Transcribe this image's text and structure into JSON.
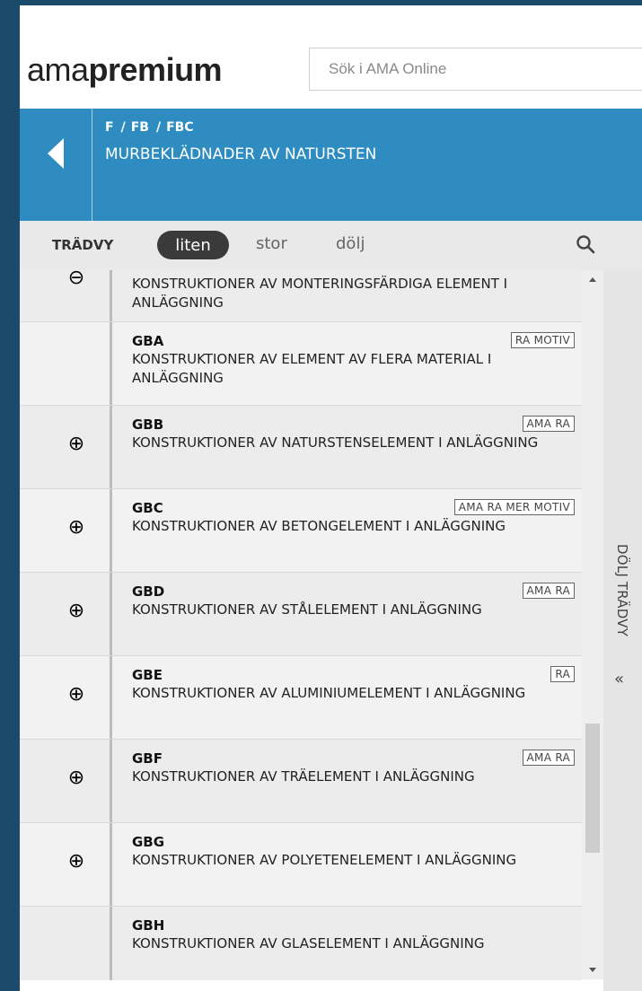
{
  "app": {
    "logo_part1": "ama",
    "logo_part2": "premium",
    "search_placeholder": "Sök i AMA Online"
  },
  "breadcrumb": {
    "items": [
      "F",
      "FB",
      "FBC"
    ],
    "separator": "/"
  },
  "section_title": "MURBEKLÄDNADER AV NATURSTEN",
  "treeview": {
    "label": "TRÄDVY",
    "options": [
      "liten",
      "stor",
      "dölj"
    ],
    "selected": "liten"
  },
  "hide_panel": {
    "label": "DÖLJ TRÄDVY",
    "icon": "double-chevron-left-icon"
  },
  "rows": [
    {
      "code": "",
      "desc": "KONSTRUKTIONER AV MONTERINGSFÄRDIGA ELEMENT I ANLÄGGNING",
      "badge": "",
      "toggle": "⊖"
    },
    {
      "code": "GBA",
      "desc": "KONSTRUKTIONER AV ELEMENT AV FLERA MATERIAL I ANLÄGGNING",
      "badge": "RA MOTIV",
      "toggle": ""
    },
    {
      "code": "GBB",
      "desc": "KONSTRUKTIONER AV NATURSTENSELEMENT I ANLÄGGNING",
      "badge": "AMA RA",
      "toggle": "⊕"
    },
    {
      "code": "GBC",
      "desc": "KONSTRUKTIONER AV BETONGELEMENT I ANLÄGGNING",
      "badge": "AMA RA MER MOTIV",
      "toggle": "⊕"
    },
    {
      "code": "GBD",
      "desc": "KONSTRUKTIONER AV STÅLELEMENT I ANLÄGGNING",
      "badge": "AMA RA",
      "toggle": "⊕"
    },
    {
      "code": "GBE",
      "desc": "KONSTRUKTIONER AV ALUMINIUMELEMENT I ANLÄGGNING",
      "badge": "RA",
      "toggle": "⊕"
    },
    {
      "code": "GBF",
      "desc": "KONSTRUKTIONER AV TRÄELEMENT I ANLÄGGNING",
      "badge": "AMA RA",
      "toggle": "⊕"
    },
    {
      "code": "GBG",
      "desc": "KONSTRUKTIONER AV POLYETENELEMENT I ANLÄGGNING",
      "badge": "",
      "toggle": "⊕"
    },
    {
      "code": "GBH",
      "desc": "KONSTRUKTIONER AV GLASELEMENT I ANLÄGGNING",
      "badge": "",
      "toggle": ""
    }
  ],
  "colors": {
    "brand_dark": "#1b4a6b",
    "bar_blue": "#2e8cc0"
  }
}
